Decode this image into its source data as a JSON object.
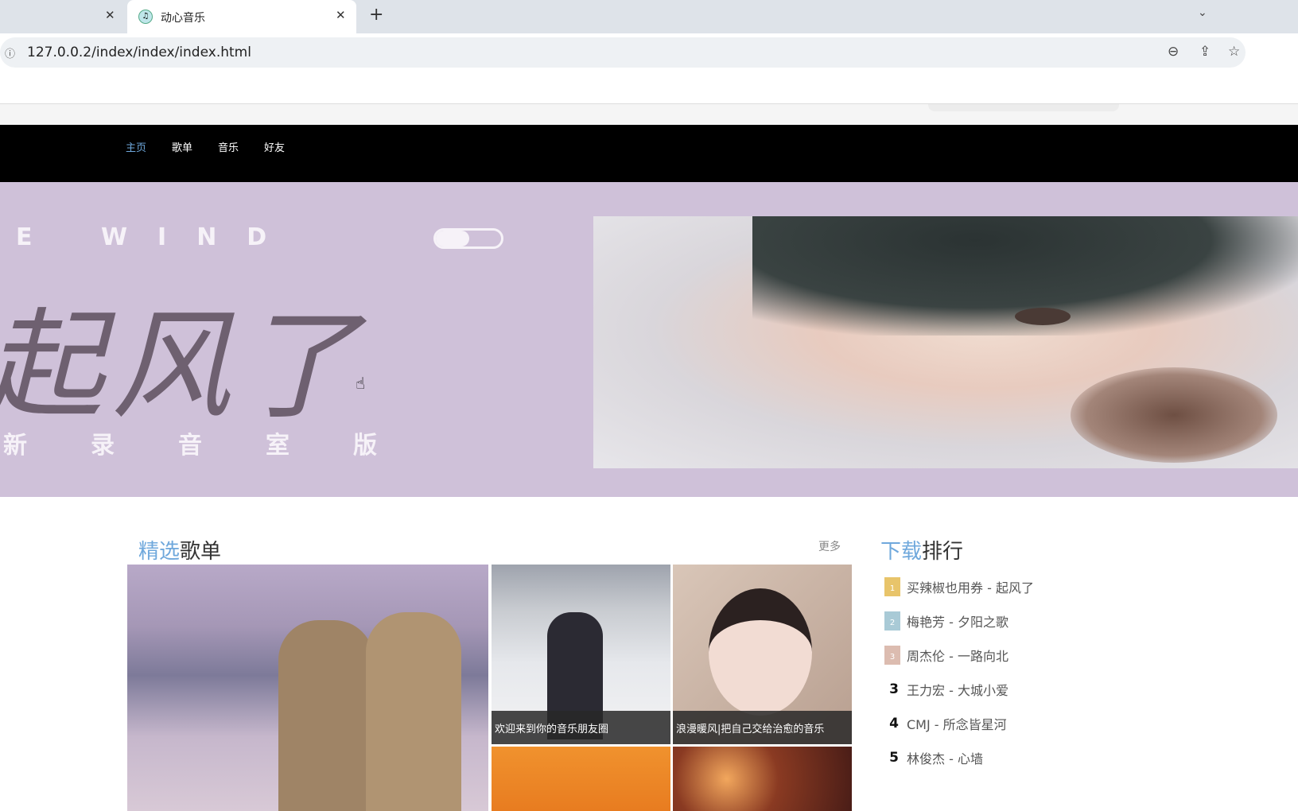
{
  "browser": {
    "prev_tab_close": "✕",
    "tab_title": "动心音乐",
    "tab_close": "✕",
    "new_tab": "+",
    "tab_menu": "⌄",
    "url": "127.0.0.2/index/index/index.html",
    "info_icon": "ⓘ",
    "zoom_icon": "⊖",
    "share_icon": "⇪",
    "star_icon": "☆"
  },
  "nav": {
    "items": [
      "主页",
      "歌单",
      "音乐",
      "好友"
    ]
  },
  "banner": {
    "wind": "E WIND",
    "callig": "起风了",
    "sub": "新录音室版"
  },
  "playlists": {
    "title_hl": "精选",
    "title": "歌单",
    "more": "更多",
    "cards": [
      "欢迎来到你的音乐朋友圈",
      "浪漫暖风|把自己交给治愈的音乐"
    ]
  },
  "ranking": {
    "title_hl": "下载",
    "title": "排行",
    "items": [
      {
        "rank": "1",
        "text": "买辣椒也用券 - 起风了",
        "color": "#e8c46a"
      },
      {
        "rank": "2",
        "text": "梅艳芳 - 夕阳之歌",
        "color": "#a9cad6"
      },
      {
        "rank": "3",
        "text": "周杰伦 - 一路向北",
        "color": "#dcbcb0"
      },
      {
        "rank": "3",
        "text": "王力宏 - 大城小爱"
      },
      {
        "rank": "4",
        "text": "CMJ - 所念皆星河"
      },
      {
        "rank": "5",
        "text": "林俊杰 - 心墙"
      }
    ]
  }
}
